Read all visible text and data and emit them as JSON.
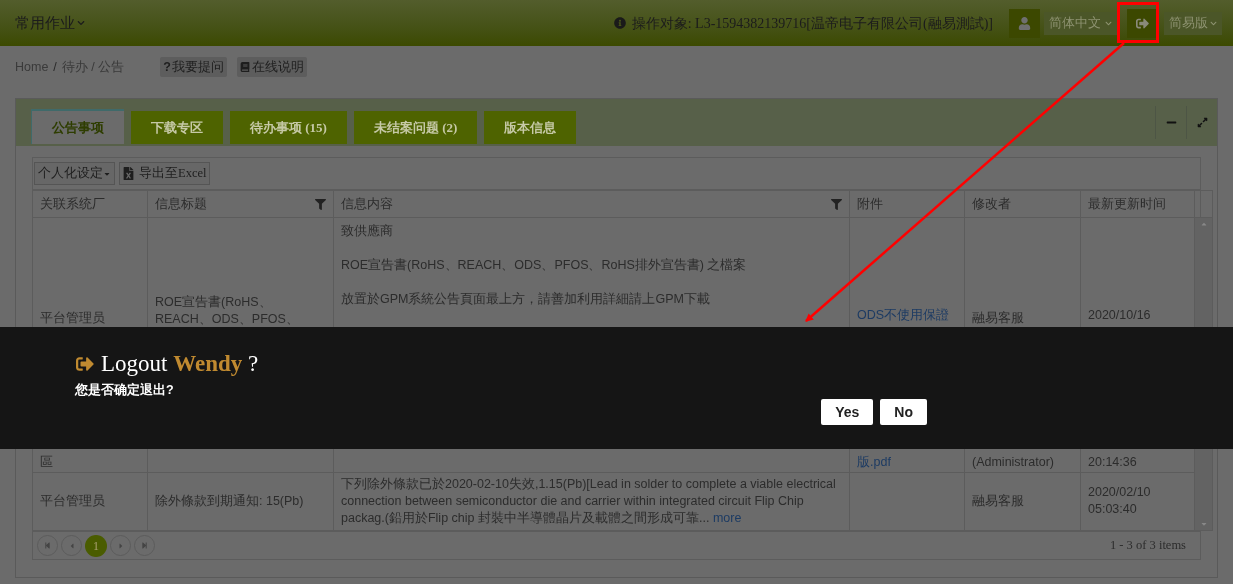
{
  "header": {
    "menu": "常用作业",
    "operator": "操作对象: L3-1594382139716[温帝电子有限公司(融易測試)]",
    "language": "简体中文",
    "mode": "简易版"
  },
  "breadcrumb": {
    "items": [
      "Home",
      "待办 / 公告"
    ],
    "separator": "/"
  },
  "help_buttons": [
    {
      "kind": "question",
      "label": "我要提问",
      "mark": "?"
    },
    {
      "kind": "book",
      "label": "在线说明"
    }
  ],
  "tabs": [
    {
      "label": "公告事项",
      "selected": true
    },
    {
      "label": "下载专区",
      "selected": false
    },
    {
      "label": "待办事项 (15)",
      "selected": false
    },
    {
      "label": "未结案问题 (2)",
      "selected": false
    },
    {
      "label": "版本信息",
      "selected": false
    }
  ],
  "toolbar": {
    "personalize": "个人化设定",
    "export": "导出至Excel"
  },
  "table": {
    "columns": [
      {
        "label": "关联系统厂",
        "filter": false
      },
      {
        "label": "信息标题",
        "filter": true
      },
      {
        "label": "信息内容",
        "filter": true
      },
      {
        "label": "附件",
        "filter": false
      },
      {
        "label": "修改者",
        "filter": false
      },
      {
        "label": "最新更新时间",
        "filter": false
      }
    ],
    "rows": [
      {
        "system": "平台管理员",
        "title": "ROE宣告書(RoHS、REACH、ODS、PFOS、",
        "content_lines": [
          "致供應商",
          "ROE宣告書(RoHS、REACH、ODS、PFOS、RoHS排外宣告書) 之檔案",
          "放置於GPM系統公告頁面最上方，請善加利用詳細請上GPM下載"
        ],
        "attachment": "ODS不使用保證",
        "modifier": "融易客服",
        "updated": "2020/10/16"
      },
      {
        "system": "區",
        "attachment": "版.pdf",
        "modifier": "(Administrator)",
        "updated": "20:14:36"
      },
      {
        "system": "平台管理员",
        "title": "除外條款到期通知: 15(Pb)",
        "content": "下列除外條款已於2020-02-10失效,1.15(Pb)[Lead in solder to complete a viable electrical connection between semiconductor die and carrier within integrated circuit Flip Chip packag.(鉛用於Flip chip 封裝中半導體晶片及載體之間形成可靠...",
        "more": "more",
        "modifier": "融易客服",
        "updated": "2020/02/10 05:03:40"
      }
    ]
  },
  "pager": {
    "pages": [
      {
        "label": "1",
        "selected": true
      }
    ],
    "summary": "1 - 3 of 3 items"
  },
  "dialog": {
    "title": "Logout",
    "user": "Wendy",
    "question_mark": "?",
    "message": "您是否确定退出?",
    "buttons": [
      "Yes",
      "No"
    ]
  }
}
